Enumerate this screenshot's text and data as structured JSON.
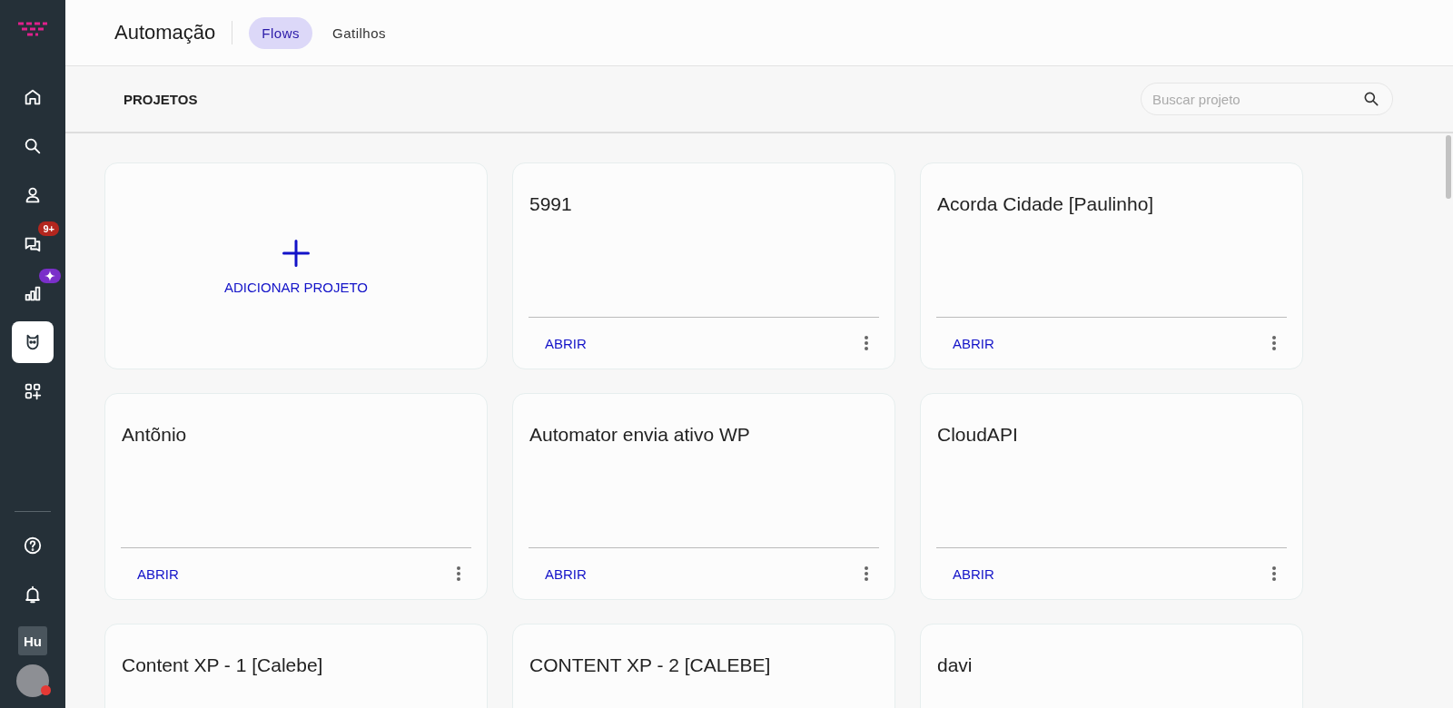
{
  "sidebar": {
    "nav": [
      {
        "kind": "home",
        "selected": false
      },
      {
        "kind": "search",
        "selected": false
      },
      {
        "kind": "person",
        "selected": false
      },
      {
        "kind": "chat",
        "selected": false,
        "badge": "9+"
      },
      {
        "kind": "chart",
        "selected": false,
        "ai_badge": true
      },
      {
        "kind": "bot",
        "selected": true
      },
      {
        "kind": "apps",
        "selected": false
      }
    ],
    "bottom": [
      {
        "kind": "help"
      },
      {
        "kind": "bell"
      }
    ],
    "workspace": "Hu"
  },
  "header": {
    "title": "Automação",
    "tabs": [
      {
        "label": "Flows",
        "selected": true
      },
      {
        "label": "Gatilhos",
        "selected": false
      }
    ]
  },
  "toolbar": {
    "heading": "PROJETOS",
    "search": {
      "placeholder": "Buscar projeto"
    }
  },
  "add_card": {
    "label": "ADICIONAR PROJETO"
  },
  "projects": [
    {
      "name": "5991",
      "action": "ABRIR"
    },
    {
      "name": "Acorda Cidade [Paulinho]",
      "action": "ABRIR"
    },
    {
      "name": "Antõnio",
      "action": "ABRIR"
    },
    {
      "name": "Automator envia ativo WP",
      "action": "ABRIR"
    },
    {
      "name": "CloudAPI",
      "action": "ABRIR"
    },
    {
      "name": "Content XP - 1 [Calebe]"
    },
    {
      "name": "CONTENT XP - 2 [CALEBE]"
    },
    {
      "name": "davi"
    }
  ]
}
